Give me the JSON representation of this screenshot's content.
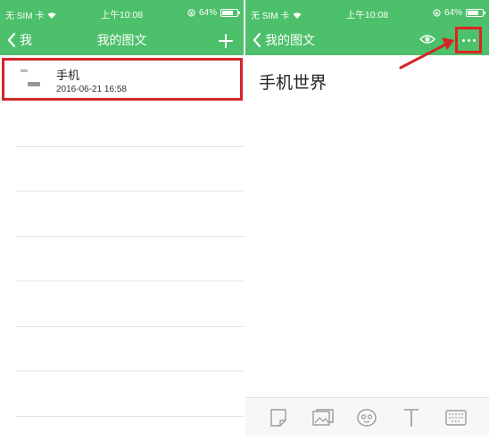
{
  "left": {
    "status": {
      "carrier": "无 SIM 卡",
      "time": "上午10:08",
      "battery": "64%"
    },
    "nav": {
      "back_label": "我",
      "title": "我的图文",
      "add_icon": "plus-icon"
    },
    "list": [
      {
        "title": "手机",
        "date": "2016-06-21 16:58"
      }
    ]
  },
  "right": {
    "status": {
      "carrier": "无 SIM 卡",
      "time": "上午10:08",
      "battery": "64%"
    },
    "nav": {
      "back_label": "我的图文",
      "preview_icon": "eye-icon",
      "more_icon": "more-icon"
    },
    "article": {
      "title": "手机世界"
    },
    "toolbar": [
      "sticker-icon",
      "image-icon",
      "emoji-icon",
      "text-icon",
      "keyboard-icon"
    ]
  },
  "colors": {
    "brand": "#4cc06a",
    "highlight": "#d4262a"
  }
}
